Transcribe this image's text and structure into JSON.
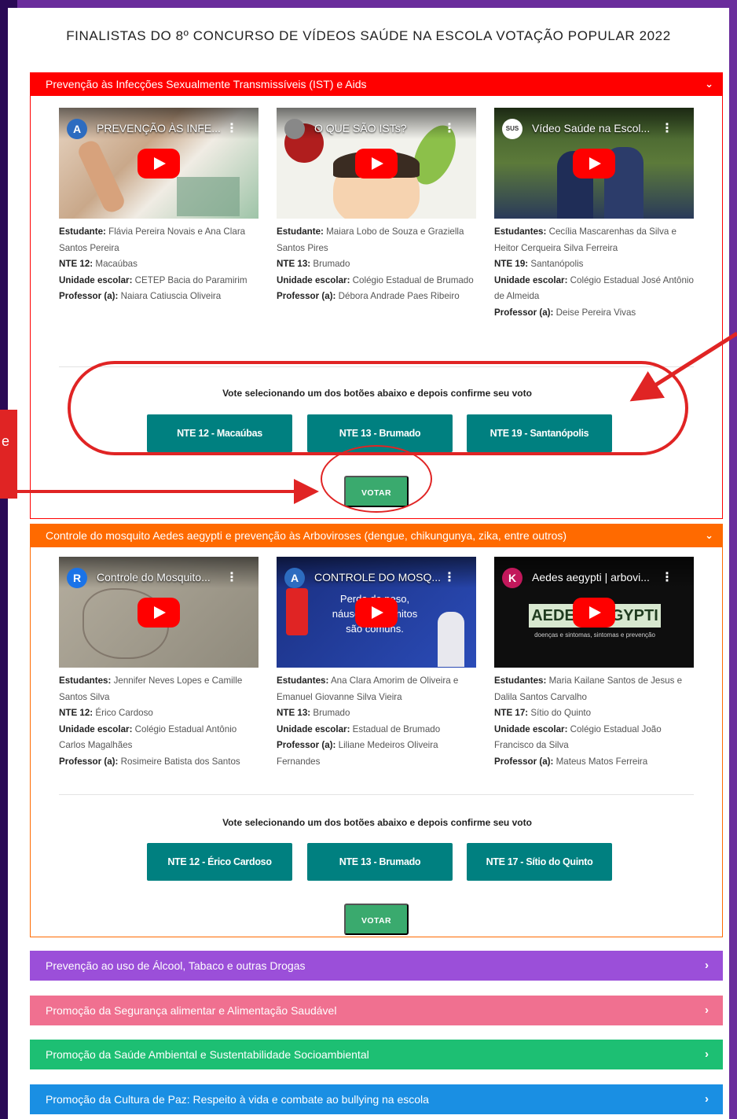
{
  "heading": "FINALISTAS DO 8º CONCURSO DE VÍDEOS SAÚDE NA ESCOLA VOTAÇÃO POPULAR 2022",
  "annotation_text": "e",
  "colors": {
    "page_bg": "#6a2d9c",
    "red": "#ff0000",
    "orange": "#ff6a00",
    "purple": "#9b4fd9",
    "pink": "#f07090",
    "green": "#1dbf73",
    "blue": "#1a8fe3",
    "teal_button": "#008080",
    "vote_button": "#3aaa6e",
    "annotation": "#e02424"
  },
  "icons": {
    "expanded": "chevron-down-icon",
    "collapsed": "chevron-right-icon",
    "play": "play-icon",
    "more": "more-vertical-icon"
  },
  "sections": [
    {
      "title": "Prevenção às Infecções Sexualmente Transmissíveis (IST) e Aids",
      "chevron": "⌄",
      "videos": [
        {
          "channel": "A",
          "title": "PREVENÇÃO ÀS INFE...",
          "student_label": "Estudante:",
          "student": "Flávia Pereira Novais e Ana Clara Santos Pereira",
          "nte_label": "NTE 12:",
          "nte": "Macaúbas",
          "school_label": "Unidade escolar:",
          "school": "CETEP Bacia do Paramirim",
          "teacher_label": "Professor (a):",
          "teacher": "Naiara Catiuscia Oliveira"
        },
        {
          "channel": "",
          "title": "O QUE SÃO ISTs?",
          "student_label": "Estudante:",
          "student": "Maiara Lobo de Souza e Graziella Santos Pires",
          "nte_label": "NTE 13:",
          "nte": "Brumado",
          "school_label": "Unidade escolar:",
          "school": "Colégio Estadual de Brumado",
          "teacher_label": "Professor (a):",
          "teacher": "Débora Andrade Paes Ribeiro"
        },
        {
          "channel": "SUS",
          "title": "Vídeo Saúde na Escol...",
          "student_label": "Estudantes:",
          "student": "Cecília Mascarenhas da Silva e Heitor Cerqueira Silva Ferreira",
          "nte_label": "NTE 19:",
          "nte": "Santanópolis",
          "school_label": "Unidade escolar:",
          "school": "Colégio Estadual José Antônio de Almeida",
          "teacher_label": "Professor (a):",
          "teacher": "Deise Pereira Vivas"
        }
      ],
      "vote_prompt": "Vote selecionando um dos botões abaixo e depois confirme seu voto",
      "options": [
        "NTE 12 - Macaúbas",
        "NTE 13 - Brumado",
        "NTE 19 - Santanópolis"
      ],
      "vote_label": "VOTAR"
    },
    {
      "title": "Controle do mosquito Aedes aegypti e prevenção às Arboviroses (dengue, chikungunya, zika, entre outros)",
      "chevron": "⌄",
      "videos": [
        {
          "channel": "R",
          "title": "Controle do Mosquito...",
          "student_label": "Estudantes:",
          "student": "Jennifer Neves Lopes e Camille Santos Silva",
          "nte_label": "NTE 12:",
          "nte": "Érico Cardoso",
          "school_label": "Unidade escolar:",
          "school": "Colégio Estadual Antônio Carlos Magalhães",
          "teacher_label": "Professor (a):",
          "teacher": "Rosimeire Batista dos Santos"
        },
        {
          "channel": "A",
          "title": "CONTROLE DO MOSQ...",
          "student_label": "Estudantes:",
          "student": "Ana Clara Amorim de Oliveira e Emanuel Giovanne Silva Vieira",
          "nte_label": "NTE 13:",
          "nte": "Brumado",
          "school_label": "Unidade escolar:",
          "school": "Estadual de Brumado",
          "teacher_label": "Professor (a):",
          "teacher": "Liliane Medeiros Oliveira Fernandes"
        },
        {
          "channel": "K",
          "title": "Aedes aegypti | arbovi...",
          "student_label": "Estudantes:",
          "student": "Maria Kailane Santos de Jesus e Dalila Santos Carvalho",
          "nte_label": "NTE 17:",
          "nte": "Sítio do Quinto",
          "school_label": "Unidade escolar:",
          "school": "Colégio Estadual João Francisco da Silva",
          "teacher_label": "Professor (a):",
          "teacher": "Mateus Matos Ferreira"
        }
      ],
      "vote_prompt": "Vote selecionando um dos botões abaixo e depois confirme seu voto",
      "options": [
        "NTE 12 - Érico Cardoso",
        "NTE 13 - Brumado",
        "NTE 17 - Sítio do Quinto"
      ],
      "vote_label": "VOTAR"
    }
  ],
  "collapsed_sections": [
    "Prevenção ao uso de Álcool, Tabaco e outras Drogas",
    "Promoção da Segurança alimentar e Alimentação Saudável",
    "Promoção da Saúde Ambiental e Sustentabilidade Socioambiental",
    "Promoção da Cultura de Paz: Respeito à vida e combate ao bullying na escola"
  ],
  "collapsed_chevron": "›",
  "thumb_overlay_1": "Perda de peso,",
  "thumb_overlay_2": "náuseas e vômitos",
  "thumb_overlay_3": "são comuns.",
  "thumb_overlay_aedes": "AEDES AEGYPTI",
  "thumb_overlay_aedes_sub": "doenças e sintomas, sintomas e prevenção"
}
